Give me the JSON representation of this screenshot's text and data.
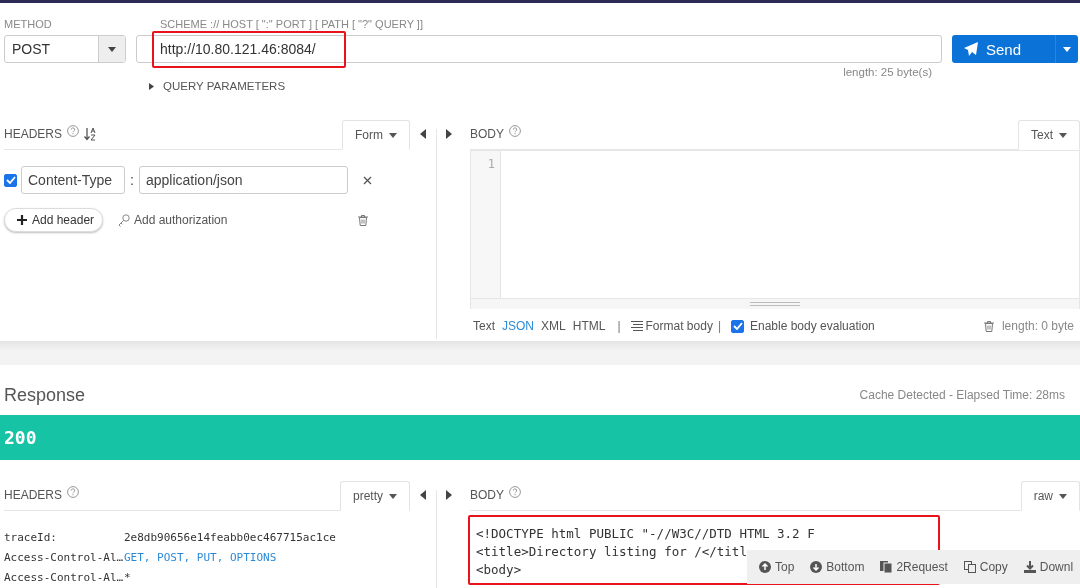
{
  "request": {
    "method_label": "METHOD",
    "method": "POST",
    "url_label": "SCHEME :// HOST [ \":\" PORT ] [ PATH [ \"?\" QUERY ]]",
    "url": "http://10.80.121.46:8084/",
    "url_highlighted": true,
    "send_label": "Send",
    "length": "length: 25 byte(s)",
    "query_parameters": {
      "label": "QUERY PARAMETERS",
      "expanded": false
    }
  },
  "request_headers": {
    "title": "HEADERS",
    "mode": "Form",
    "rows": [
      {
        "checked": true,
        "name": "Content-Type",
        "separator": ":",
        "value": "application/json"
      }
    ],
    "add_header": "Add header",
    "add_authorization": "Add authorization"
  },
  "request_body": {
    "title": "BODY",
    "mode": "Text",
    "line_numbers": [
      "1"
    ],
    "formats": [
      {
        "label": "Text",
        "selected": false
      },
      {
        "label": "JSON",
        "selected": true
      },
      {
        "label": "XML",
        "selected": false
      },
      {
        "label": "HTML",
        "selected": false
      }
    ],
    "divider": "|",
    "format_body": "Format body",
    "enable_evaluation": {
      "label": "Enable body evaluation",
      "checked": true
    },
    "length": "length: 0 byte"
  },
  "response": {
    "title": "Response",
    "timing": "Cache Detected - Elapsed Time: 28ms",
    "status": "200",
    "headers_title": "HEADERS",
    "headers_mode": "pretty",
    "headers": [
      {
        "name": "traceId:",
        "value": "2e8db90656e14feabb0ec467715ac1ce",
        "kind": "plain"
      },
      {
        "name": "Access-Control-Al…",
        "value": "GET, POST, PUT, OPTIONS",
        "kind": "keyword"
      },
      {
        "name": "Access-Control-Al…",
        "value": "*",
        "kind": "plain"
      }
    ],
    "body_title": "BODY",
    "body_mode": "raw",
    "body_highlighted": true,
    "body_lines": [
      "<!DOCTYPE html PUBLIC \"-//W3C//DTD HTML 3.2 F",
      "<title>Directory listing for /</titl",
      "<body>"
    ],
    "toolbar": [
      {
        "kind": "top",
        "label": "Top"
      },
      {
        "kind": "bottom",
        "label": "Bottom"
      },
      {
        "kind": "request",
        "label": "2Request"
      },
      {
        "kind": "copy",
        "label": "Copy"
      },
      {
        "kind": "download",
        "label": "Downl"
      }
    ]
  }
}
